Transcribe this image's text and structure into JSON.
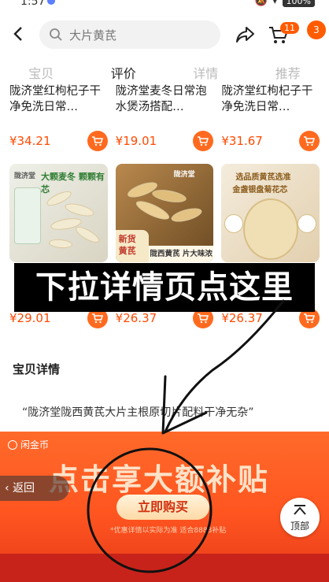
{
  "status": {
    "time": "1:57",
    "battery": "100%"
  },
  "header": {
    "search_text": "大片黄芪",
    "cart_count": "11",
    "more_count": "3"
  },
  "tabs": [
    {
      "label": "宝贝",
      "active": false
    },
    {
      "label": "评价",
      "active": true
    },
    {
      "label": "详情",
      "active": false
    },
    {
      "label": "推荐",
      "active": false
    }
  ],
  "row1": [
    {
      "name": "陇济堂红枸杞子干净免洗日常…",
      "price": "¥34.21"
    },
    {
      "name": "陇济堂麦冬日常泡水煲汤搭配…",
      "price": "¥19.01"
    },
    {
      "name": "陇济堂红枸杞子干净免洗日常…",
      "price": "¥31.67"
    }
  ],
  "row2": [
    {
      "tag1": "大颗麦冬 颗颗有芯",
      "tag2": "陇济堂",
      "price": "¥29.01"
    },
    {
      "tag1": "陇济堂",
      "tag2": "新货 黄芪",
      "tag3": "陇西黄芪 片大味浓",
      "price": "¥26.37"
    },
    {
      "tag1": "选品质黄芪选准",
      "tag2": "金盏银盘菊花芯",
      "price": "¥26.37"
    }
  ],
  "overlay_text": "下拉详情页点这里",
  "detail": {
    "section_title": "宝贝详情",
    "quote": "“陇济堂陇西黄芪大片主根原切片配料干净无杂”"
  },
  "promo": {
    "logo": "闲金币",
    "title": "点击享大额补贴",
    "button": "立即购买",
    "note": "*优惠详情以实际为准 适合8888补贴",
    "return_label": "返回",
    "top_label": "顶部"
  },
  "colors": {
    "accent": "#ff5b00",
    "price": "#ff4a00",
    "promo": "#ff5520"
  }
}
